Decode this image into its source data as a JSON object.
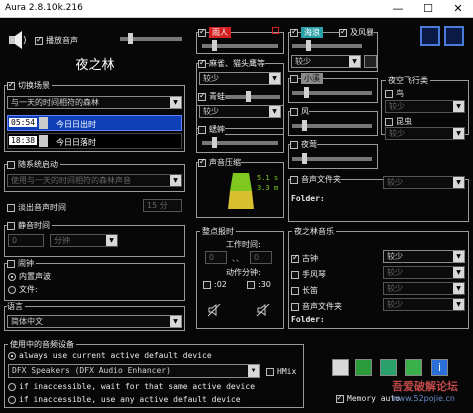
{
  "window": {
    "title": "Aura 2.8.10k.216",
    "min": "—",
    "max": "☐",
    "close": "✕"
  },
  "left": {
    "play_sound": "播放音声",
    "scene_title": "夜之林",
    "switch_scene": "切换场景",
    "scene_mode": "与一天的时间相符的森林",
    "time1": "05:54",
    "time1_label": "今日日出时",
    "time2": "18:38",
    "time2_label": "今日日落时",
    "random_start": "随系统启动",
    "random_mode": "使用与一天的时间相符的森林声音",
    "fade_time_label": "淡出音声时间",
    "fade_value": "15 分",
    "mute_time_label": "静音时间",
    "mute_value": "0",
    "mute_unit": "分钟",
    "alarm_label": "闹钟",
    "alarm_builtin": "内置声波",
    "alarm_file": "文件:",
    "language_label": "语言",
    "language_value": "简体中文"
  },
  "mid": {
    "item1_label": "雨人",
    "item2_label": "麻雀、猫头鹰等",
    "item2_value": "较少",
    "item3_label": "青蛙",
    "item3_value": "较少",
    "item4_label": "蟋蟀",
    "sound_plot_label": "声音压缩",
    "plot_val1": "5.1 s",
    "plot_val2": "3.3 m",
    "schedule_label": "整点报时",
    "work_time_label": "工作时间:",
    "work_from": "0",
    "work_to": "0",
    "action_label": "动作分钟:",
    "opt1": ":02",
    "opt2": ":30"
  },
  "right": {
    "top_label": "海浪",
    "top_sub": "及风暴",
    "top_value": "较少",
    "r2_label": "小溪",
    "r3_label": "风",
    "r4_label": "夜莺",
    "r5_label": "音声文件夹",
    "r5_folder": "Folder:",
    "flying_label": "夜空飞行类",
    "bird_label": "鸟",
    "bird_value": "较少",
    "insect_label": "昆虫",
    "insect_value": "较少",
    "night_group": "夜之林音乐",
    "n1": "古钟",
    "n1v": "较少",
    "n2": "手风琴",
    "n2v": "较少",
    "n3": "长笛",
    "n3v": "较少",
    "n4": "音声文件夹",
    "n4v": "较少",
    "n4_folder": "Folder:"
  },
  "bottom": {
    "group_label": "使用中的音频设备",
    "opt_default": "always use current active default device",
    "device": "DFX Speakers (DFX Audio Enhancer)",
    "hmix": "HMix",
    "opt_wait": "if inaccessible, wait for that same active device",
    "opt_any": "if inaccessible, use any active default device",
    "memory": "Memory auto",
    "watermark": "吾爱破解论坛",
    "watermark_url": "www.52pojie.cn"
  },
  "colors": {
    "accent_red": "#d42020",
    "accent_blue": "#3a62c8",
    "accent_teal": "#2aa0a8",
    "plot_green": "#7ec820",
    "plot_yellow": "#d8c030"
  }
}
